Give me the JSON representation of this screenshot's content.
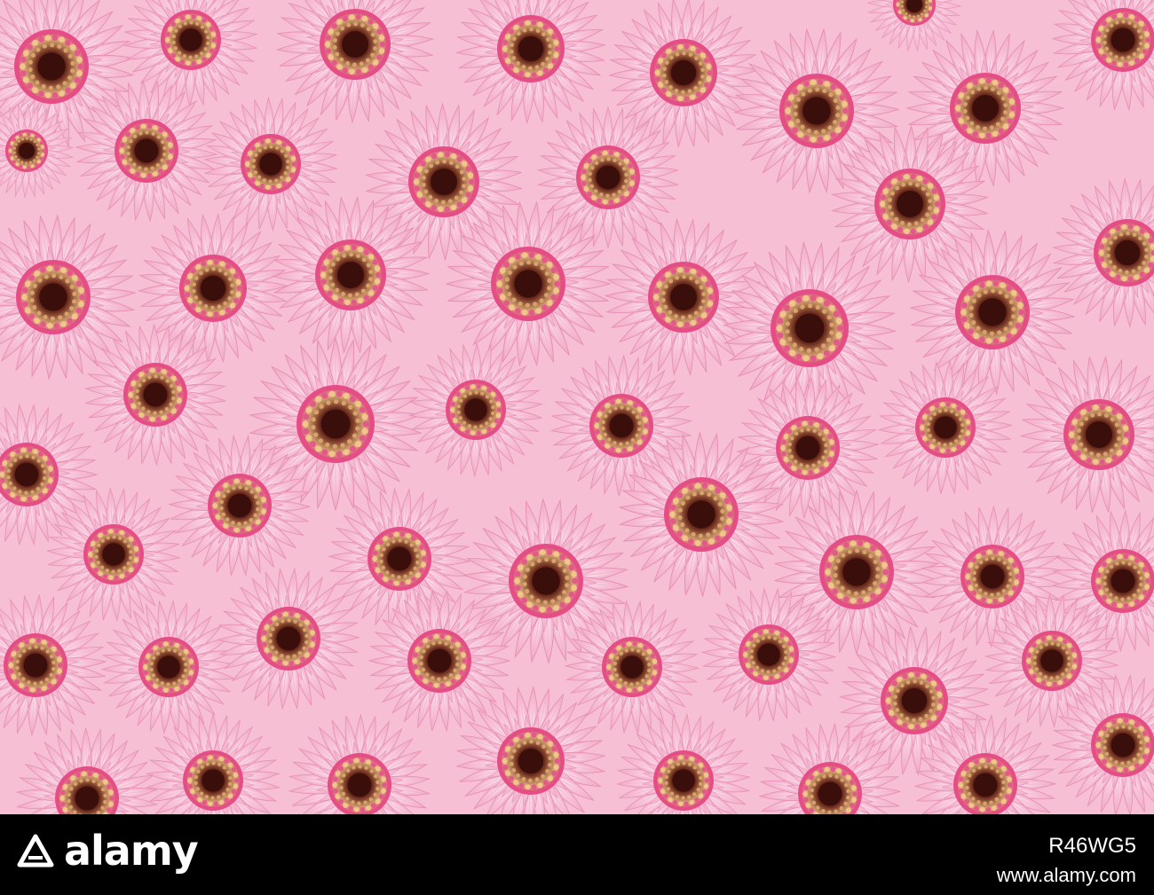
{
  "photo": {
    "subject": "pink-gerbera-daisy-pattern",
    "colors": {
      "background": "#f6bfd3",
      "petal_outer": "#f2a9c6",
      "petal_inner": "#fbd9e7",
      "petal_edge": "#e889b0",
      "center_ring": "#e1457f",
      "center_stamen": "#d8a76f",
      "center_disc": "#5a1f16"
    }
  },
  "watermark": {
    "brand": "alamy",
    "image_id": "R46WG5",
    "site_url": "www.alamy.com",
    "colors": {
      "bar": "#000000",
      "text": "#ffffff"
    }
  }
}
